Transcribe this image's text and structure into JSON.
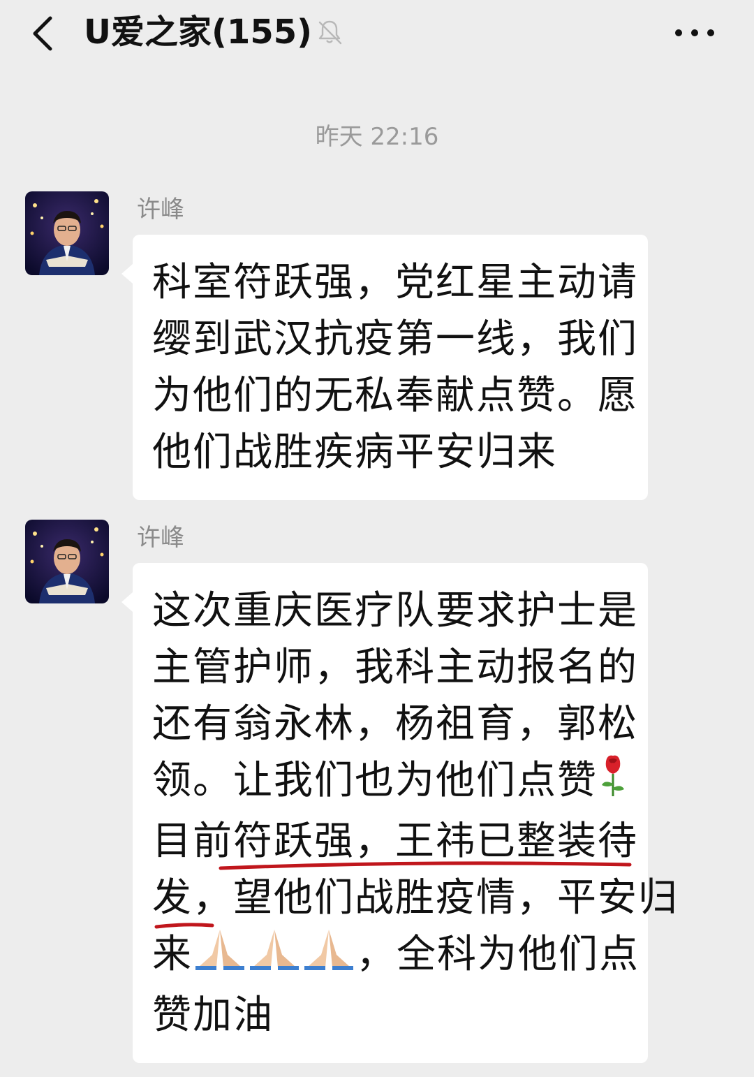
{
  "header": {
    "title": "U爱之家(155)",
    "back_icon": "chevron-left-icon",
    "mute_icon": "bell-off-icon",
    "more_icon": "more-dots-icon"
  },
  "timestamp": "昨天 22:16",
  "messages": [
    {
      "sender": "许峰",
      "lines": [
        "科室符跃强，党红星主动请",
        "缨到武汉抗疫第一线，我们",
        "为他们的无私奉献点赞。愿",
        "他们战胜疾病平安归来"
      ]
    },
    {
      "sender": "许峰",
      "lines": [
        "这次重庆医疗队要求护士是",
        "主管护师，我科主动报名的",
        "还有翁永林，杨祖育，郭松",
        "领。让我们也为他们点赞",
        "目前符跃强，王祎已整装待",
        "发，望他们战胜疫情，平安归",
        "来",
        "，全科为他们点",
        "赞加油"
      ],
      "emoji_rose": "rose-emoji",
      "emoji_pray": "folded-hands-emoji",
      "annotation_color": "#c0161c"
    }
  ]
}
